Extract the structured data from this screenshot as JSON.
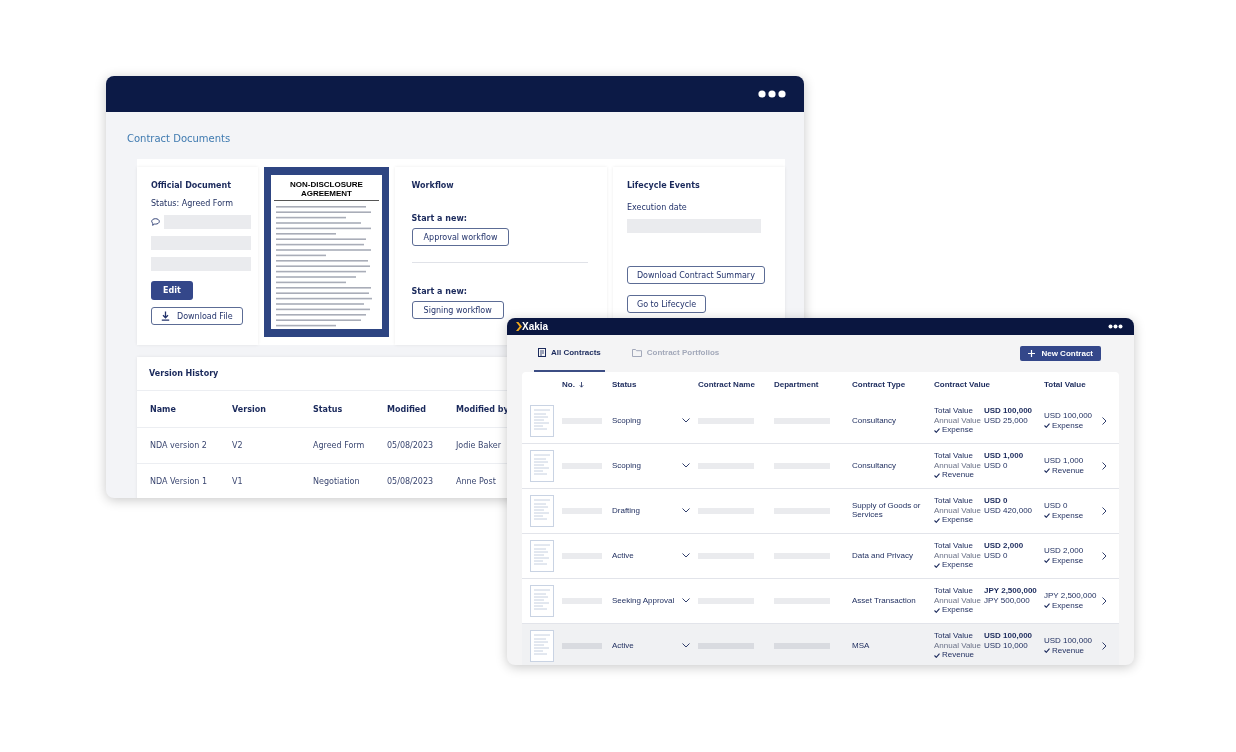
{
  "documents_window": {
    "page_title": "Contract Documents",
    "official_document": {
      "heading": "Official Document",
      "status": "Status: Agreed Form",
      "edit_button": "Edit",
      "download_button": "Download File"
    },
    "document_preview": {
      "title": "NON-DISCLOSURE AGREEMENT"
    },
    "workflow": {
      "heading": "Workflow",
      "sections": [
        {
          "label": "Start a new:",
          "button": "Approval workflow"
        },
        {
          "label": "Start a new:",
          "button": "Signing workflow"
        }
      ]
    },
    "lifecycle": {
      "heading": "Lifecycle Events",
      "field_label": "Execution date",
      "buttons": [
        "Download Contract Summary",
        "Go to Lifecycle"
      ]
    },
    "version_history": {
      "heading": "Version History",
      "columns": [
        "Name",
        "Version",
        "Status",
        "Modified",
        "Modified by"
      ],
      "rows": [
        [
          "NDA version 2",
          "V2",
          "Agreed Form",
          "05/08/2023",
          "Jodie Baker"
        ],
        [
          "NDA Version 1",
          "V1",
          "Negotiation",
          "05/08/2023",
          "Anne Post"
        ]
      ]
    }
  },
  "contracts_window": {
    "logo": "Xakia",
    "tabs": [
      {
        "label": "All Contracts",
        "selected": true
      },
      {
        "label": "Contract Portfolios",
        "selected": false
      }
    ],
    "new_button": "New Contract",
    "columns": [
      "No.",
      "Status",
      "Contract Name",
      "Department",
      "Contract Type",
      "Contract Value",
      "Total Value"
    ],
    "rows": [
      {
        "status": "Scoping",
        "type": "Consultancy",
        "total_label": "Total Value",
        "annual_label": "Annual Value",
        "total": "USD 100,000",
        "annual": "USD 25,000",
        "flow": "Expense",
        "total_value": "USD 100,000",
        "total_flow": "Expense",
        "selected": false
      },
      {
        "status": "Scoping",
        "type": "Consultancy",
        "total_label": "Total Value",
        "annual_label": "Annual Value",
        "total": "USD 1,000",
        "annual": "USD 0",
        "flow": "Revenue",
        "total_value": "USD 1,000",
        "total_flow": "Revenue",
        "selected": false
      },
      {
        "status": "Drafting",
        "type": "Supply of Goods or Services",
        "total_label": "Total Value",
        "annual_label": "Annual Value",
        "total": "USD 0",
        "annual": "USD 420,000",
        "flow": "Expense",
        "total_value": "USD 0",
        "total_flow": "Expense",
        "selected": false
      },
      {
        "status": "Active",
        "type": "Data and Privacy",
        "total_label": "Total Value",
        "annual_label": "Annual Value",
        "total": "USD 2,000",
        "annual": "USD 0",
        "flow": "Expense",
        "total_value": "USD 2,000",
        "total_flow": "Expense",
        "selected": false
      },
      {
        "status": "Seeking Approval",
        "type": "Asset Transaction",
        "total_label": "Total Value",
        "annual_label": "Annual Value",
        "total": "JPY 2,500,000",
        "annual": "JPY 500,000",
        "flow": "Expense",
        "total_value": "JPY 2,500,000",
        "total_flow": "Expense",
        "selected": false
      },
      {
        "status": "Active",
        "type": "MSA",
        "total_label": "Total Value",
        "annual_label": "Annual Value",
        "total": "USD 100,000",
        "annual": "USD 10,000",
        "flow": "Revenue",
        "total_value": "USD 100,000",
        "total_flow": "Revenue",
        "selected": true
      }
    ]
  }
}
